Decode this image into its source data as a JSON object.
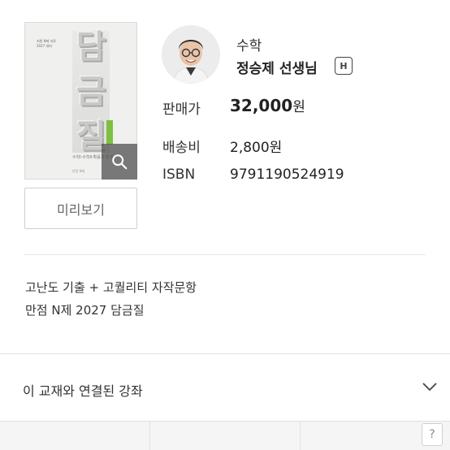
{
  "book": {
    "cover_small_text": [
      "지원 N제 자료",
      "2027 대비"
    ],
    "cover_title_chars": [
      "담",
      "금",
      "질"
    ],
    "cover_subtitle": "수학Ⅰ·수학Ⅱ·확률과 통계",
    "cover_bottom": "만점 N제",
    "zoom_icon": "magnifier-icon",
    "preview_label": "미리보기"
  },
  "teacher": {
    "subject": "수학",
    "name": "정승제 선생님",
    "badge": "H"
  },
  "info": {
    "price_label": "판매가",
    "price_value": "32,000",
    "price_unit": "원",
    "shipping_label": "배송비",
    "shipping_value": "2,800원",
    "isbn_label": "ISBN",
    "isbn_value": "9791190524919"
  },
  "description": {
    "line1": "고난도 기출 + 고퀄리티 자작문항",
    "line2": "만점 N제 2027 담금질"
  },
  "related": {
    "label": "이 교재와 연결된 강좌",
    "icon": "chevron-down-icon"
  },
  "help": {
    "label": "?"
  }
}
